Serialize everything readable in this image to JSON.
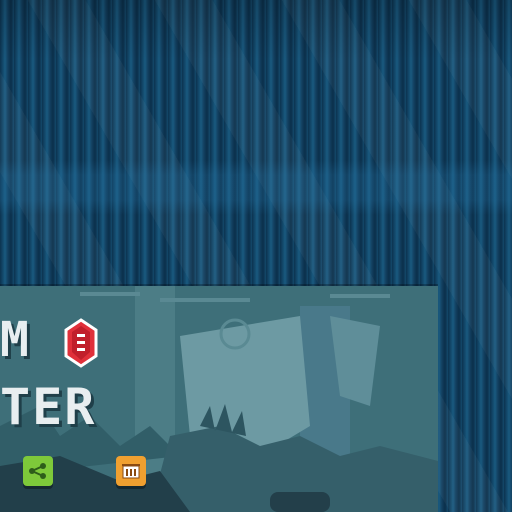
{
  "title": {
    "line1": "M",
    "line2": "TER"
  },
  "buttons": {
    "share": {
      "icon": "share-icon",
      "color": "#7ec93a"
    },
    "leaderboard": {
      "icon": "leaderboard-icon",
      "color": "#f0a030"
    }
  },
  "gem": {
    "icon": "red-gem-icon",
    "color": "#e0303a"
  },
  "colors": {
    "curtain": "#134a6c",
    "card": "#3e6f79",
    "title_text": "#e8eef0"
  }
}
